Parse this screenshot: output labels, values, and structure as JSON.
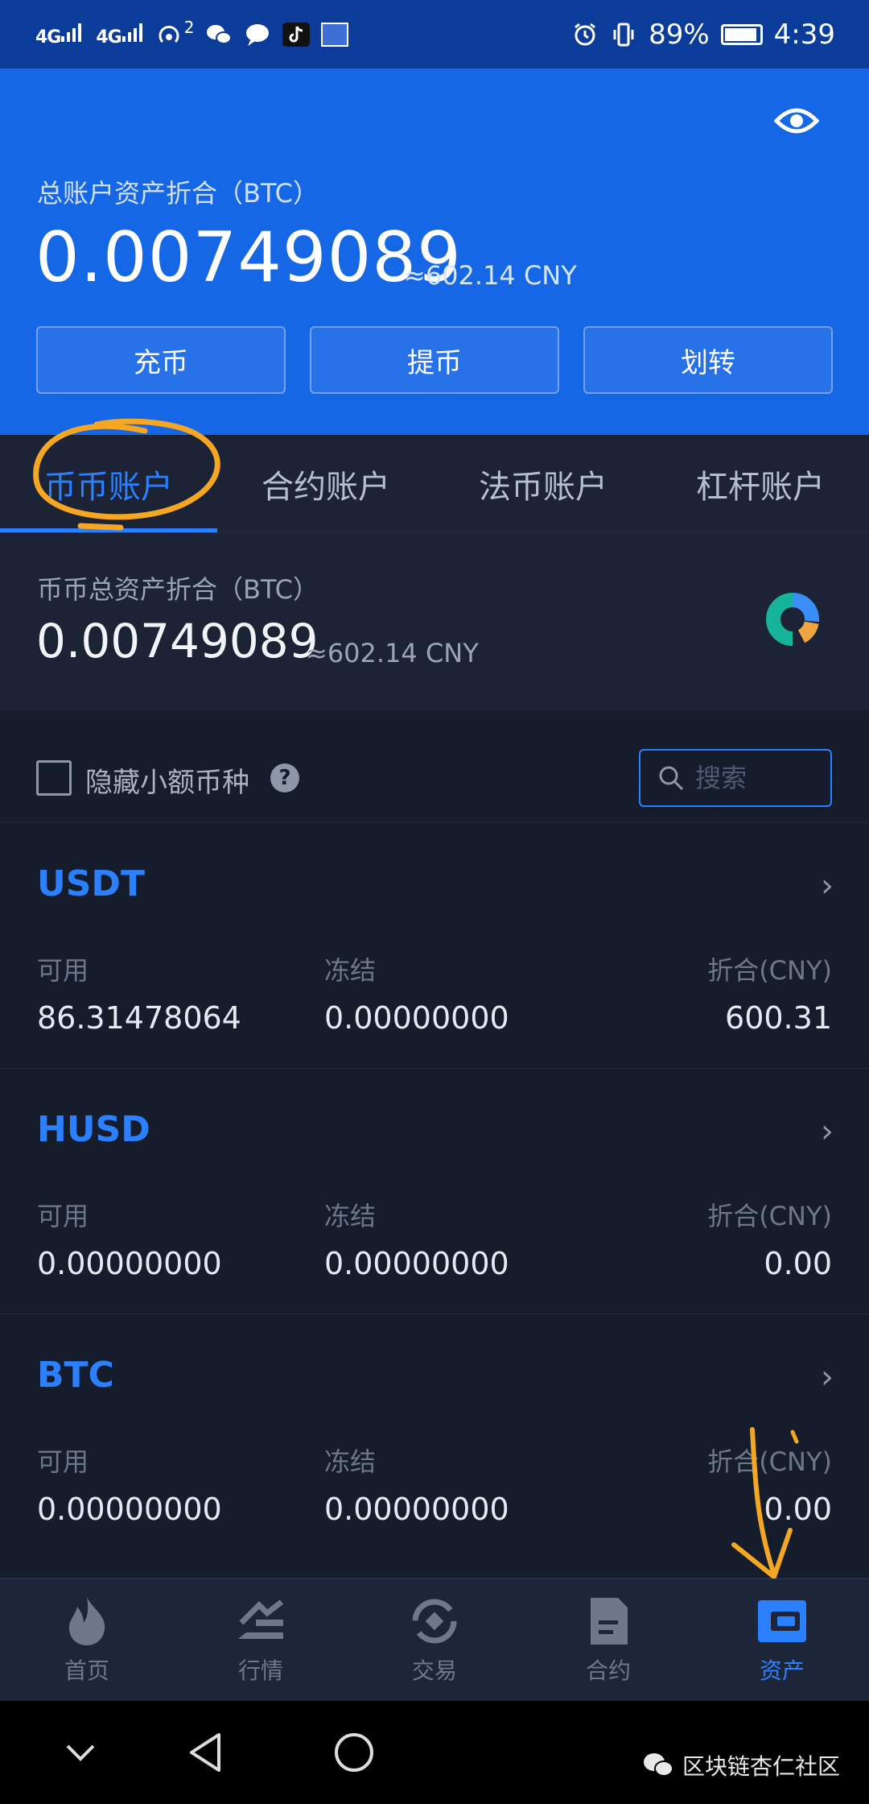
{
  "status_bar": {
    "signal1": "4G",
    "signal2": "4G",
    "notification_count": "2",
    "battery": "89%",
    "time": "4:39",
    "icons": [
      "signal-icon",
      "signal-icon",
      "hotspot-icon",
      "wechat-icon",
      "message-icon",
      "tiktok-icon",
      "app-icon",
      "alarm-icon",
      "vibrate-icon",
      "battery-icon"
    ]
  },
  "header": {
    "total_label": "总账户资产折合（BTC）",
    "total_value": "0.00749089",
    "total_cny": "≈602.14 CNY",
    "buttons": [
      "充币",
      "提币",
      "划转"
    ]
  },
  "tabs": [
    {
      "label": "币币账户",
      "active": true
    },
    {
      "label": "合约账户",
      "active": false
    },
    {
      "label": "法币账户",
      "active": false
    },
    {
      "label": "杠杆账户",
      "active": false
    }
  ],
  "sub_summary": {
    "label": "币币总资产折合（BTC）",
    "value": "0.00749089",
    "cny": "≈602.14 CNY"
  },
  "filter": {
    "hide_small_label": "隐藏小额币种",
    "help_glyph": "?",
    "search_placeholder": "搜索"
  },
  "columns": {
    "available": "可用",
    "frozen": "冻结",
    "equivalent": "折合(CNY)"
  },
  "coins": [
    {
      "name": "USDT",
      "available": "86.31478064",
      "frozen": "0.00000000",
      "cny": "600.31"
    },
    {
      "name": "HUSD",
      "available": "0.00000000",
      "frozen": "0.00000000",
      "cny": "0.00"
    },
    {
      "name": "BTC",
      "available": "0.00000000",
      "frozen": "0.00000000",
      "cny": "0.00"
    }
  ],
  "bottom_nav": [
    {
      "label": "首页",
      "icon": "flame-icon",
      "active": false
    },
    {
      "label": "行情",
      "icon": "chart-icon",
      "active": false
    },
    {
      "label": "交易",
      "icon": "exchange-icon",
      "active": false
    },
    {
      "label": "合约",
      "icon": "contract-icon",
      "active": false
    },
    {
      "label": "资产",
      "icon": "wallet-icon",
      "active": true
    }
  ],
  "watermark": "区块链杏仁社区",
  "colors": {
    "header_blue": "#1567e6",
    "accent": "#2b80ff",
    "background": "#151c2c",
    "annotation": "#f5a623"
  }
}
